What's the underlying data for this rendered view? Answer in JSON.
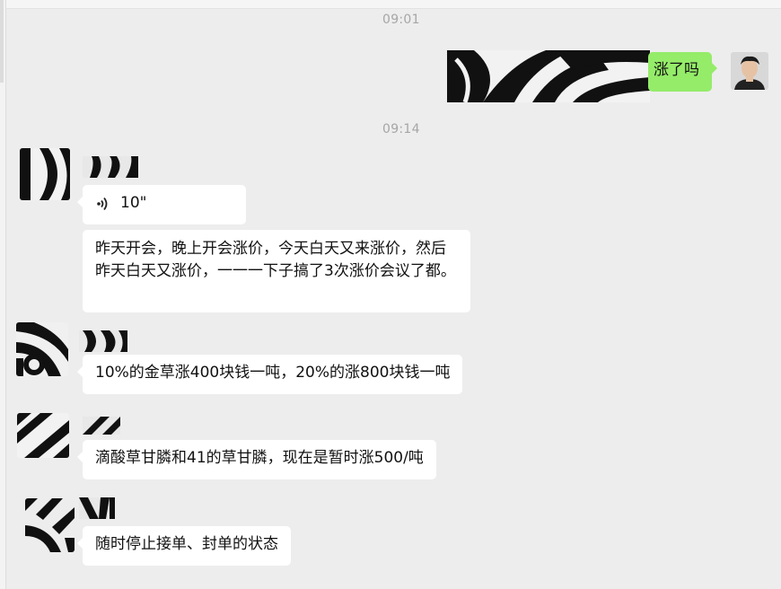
{
  "chat": {
    "timestamps": [
      "09:01",
      "09:14"
    ],
    "outgoing": {
      "text": "涨了吗",
      "avatar_icon": "user-photo-avatar"
    },
    "incoming": [
      {
        "type": "voice",
        "duration": "10\"",
        "icon": "voice-wave-icon"
      },
      {
        "type": "text",
        "text": "昨天开会，晚上开会涨价，今天白天又来涨价，然后昨天白天又涨价，一一一下子搞了3次涨价会议了都。"
      },
      {
        "type": "text",
        "text": "10%的金草涨400块钱一吨，20%的涨800块钱一吨"
      },
      {
        "type": "text",
        "text": "滴酸草甘膦和41的草甘膦，现在是暂时涨500/吨"
      },
      {
        "type": "text",
        "text": "随时停止接单、封单的状态"
      }
    ]
  },
  "colors": {
    "background": "#ededed",
    "incoming_bubble": "#ffffff",
    "outgoing_bubble": "#95ec69",
    "timestamp": "#a6a6a6"
  }
}
